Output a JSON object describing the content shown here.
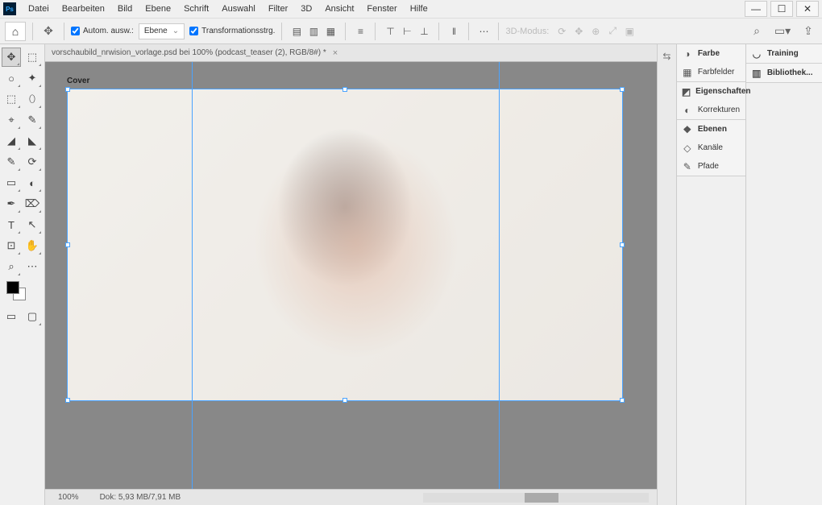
{
  "menu": [
    "Datei",
    "Bearbeiten",
    "Bild",
    "Ebene",
    "Schrift",
    "Auswahl",
    "Filter",
    "3D",
    "Ansicht",
    "Fenster",
    "Hilfe"
  ],
  "options": {
    "auto_select": "Autom. ausw.:",
    "mode": "Ebene",
    "transform_controls": "Transformationsstrg.",
    "mode3d_label": "3D-Modus:"
  },
  "doc_tab": "vorschaubild_nrwision_vorlage.psd bei 100% (podcast_teaser (2), RGB/8#) *",
  "artboard_label": "Cover",
  "status": {
    "zoom": "100%",
    "doc": "Dok: 5,93 MB/7,91 MB"
  },
  "panels_left": [
    {
      "group": [
        {
          "icon": "◑",
          "label": "Farbe",
          "bold": true
        },
        {
          "icon": "▦",
          "label": "Farbfelder"
        }
      ]
    },
    {
      "group": [
        {
          "icon": "◩",
          "label": "Eigenschaften",
          "bold": true
        },
        {
          "icon": "◐",
          "label": "Korrekturen"
        }
      ]
    },
    {
      "group": [
        {
          "icon": "❖",
          "label": "Ebenen",
          "bold": true
        },
        {
          "icon": "◇",
          "label": "Kanäle"
        },
        {
          "icon": "✎",
          "label": "Pfade"
        }
      ]
    }
  ],
  "panels_right": [
    {
      "group": [
        {
          "icon": "◡",
          "label": "Training",
          "bold": true
        }
      ]
    },
    {
      "group": [
        {
          "icon": "▥",
          "label": "Bibliothek...",
          "bold": true
        }
      ]
    }
  ],
  "tools": [
    [
      "✥",
      "⬚"
    ],
    [
      "○",
      "✦"
    ],
    [
      "⬚",
      "⬯"
    ],
    [
      "⌖",
      "✎"
    ],
    [
      "◢",
      "◣"
    ],
    [
      "✎",
      "⟳"
    ],
    [
      "▭",
      "◐"
    ],
    [
      "✒",
      "⌦"
    ],
    [
      "T",
      "↖"
    ],
    [
      "⊡",
      "✋"
    ],
    [
      "⌕",
      "⋯"
    ]
  ],
  "bottom_tools": [
    "▭",
    "▢"
  ]
}
